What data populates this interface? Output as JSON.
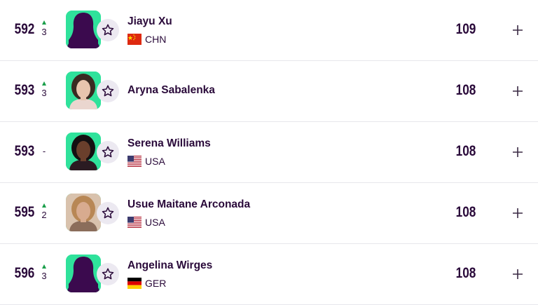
{
  "rows": [
    {
      "rank": "592",
      "movement": "3",
      "movement_dir": "up",
      "name": "Jiayu Xu",
      "country_code": "CHN",
      "flag": "china-flag",
      "points": "109",
      "avatar": "silhouette-placeholder"
    },
    {
      "rank": "593",
      "movement": "3",
      "movement_dir": "up",
      "name": "Aryna Sabalenka",
      "country_code": "",
      "flag": "",
      "points": "108",
      "avatar": "player-photo"
    },
    {
      "rank": "593",
      "movement": "-",
      "movement_dir": "none",
      "name": "Serena Williams",
      "country_code": "USA",
      "flag": "usa-flag",
      "points": "108",
      "avatar": "player-photo"
    },
    {
      "rank": "595",
      "movement": "2",
      "movement_dir": "up",
      "name": "Usue Maitane Arconada",
      "country_code": "USA",
      "flag": "usa-flag",
      "points": "108",
      "avatar": "player-photo"
    },
    {
      "rank": "596",
      "movement": "3",
      "movement_dir": "up",
      "name": "Angelina Wirges",
      "country_code": "GER",
      "flag": "germany-flag",
      "points": "108",
      "avatar": "silhouette-placeholder"
    }
  ],
  "icons": {
    "favorite": "star-icon",
    "add": "plus-icon",
    "movement_up": "arrow-up-icon"
  },
  "colors": {
    "text": "#2a0a3a",
    "avatar_bg": "#2fe29b",
    "silhouette": "#3b0a4e",
    "up_arrow": "#1a9e4a",
    "favorite_bg": "#ece9f1",
    "divider": "#e7e7ec"
  }
}
